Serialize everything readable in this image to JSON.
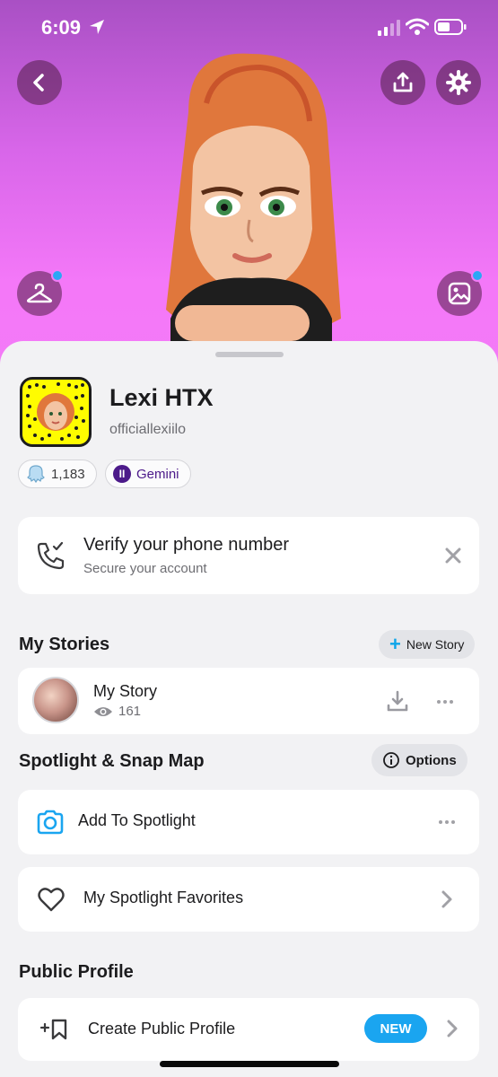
{
  "status_bar": {
    "time": "6:09"
  },
  "profile": {
    "display_name": "Lexi HTX",
    "username": "officiallexiilo",
    "friend_count": "1,183",
    "zodiac": "Gemini",
    "zodiac_symbol": "II"
  },
  "verify": {
    "title": "Verify your phone number",
    "subtitle": "Secure your account"
  },
  "my_stories": {
    "section_title": "My Stories",
    "new_story_label": "New Story",
    "new_story_plus": "+",
    "story_title": "My Story",
    "views": "161"
  },
  "spotlight": {
    "section_title": "Spotlight & Snap Map",
    "options_label": "Options",
    "add_label": "Add To Spotlight",
    "favorites_label": "My Spotlight Favorites"
  },
  "public_profile": {
    "section_title": "Public Profile",
    "create_label": "Create Public Profile",
    "bookmark_plus": "+",
    "badge": "NEW"
  },
  "colors": {
    "hero_top": "#a950c4",
    "hero_bottom": "#f37af7",
    "accent_blue": "#1aa5f0",
    "snapcode_yellow": "#fffc00",
    "zodiac_purple": "#4c1a8a"
  },
  "icons": [
    "location-arrow-icon",
    "signal-icon",
    "wifi-icon",
    "battery-icon",
    "back-icon",
    "share-icon",
    "gear-icon",
    "hanger-icon",
    "gallery-icon",
    "phone-check-icon",
    "close-icon",
    "plus-icon",
    "eye-icon",
    "download-icon",
    "more-icon",
    "info-icon",
    "camera-icon",
    "heart-icon",
    "chevron-right-icon",
    "bookmark-plus-icon"
  ]
}
